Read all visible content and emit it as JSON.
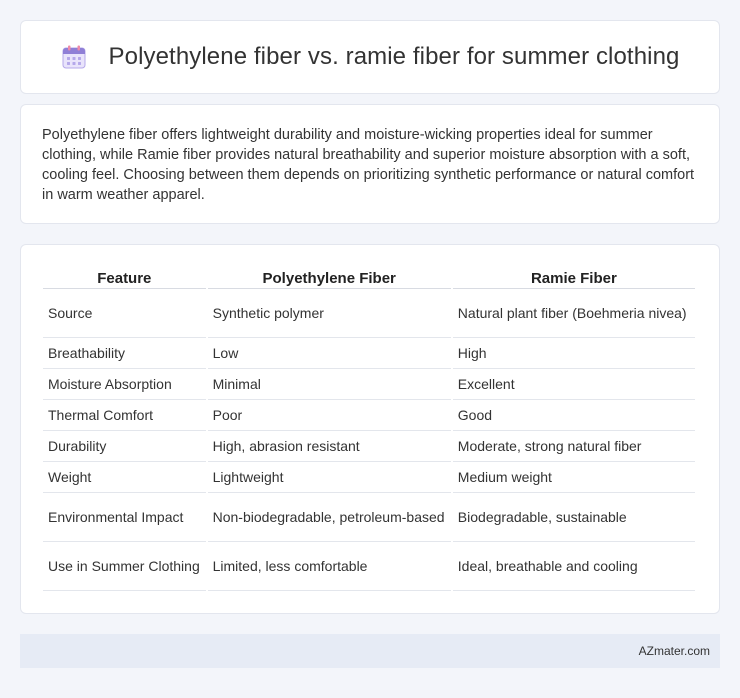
{
  "header": {
    "title": "Polyethylene fiber vs. ramie fiber for summer clothing",
    "icon": "calendar-icon"
  },
  "summary": {
    "text": "Polyethylene fiber offers lightweight durability and moisture-wicking properties ideal for summer clothing, while Ramie fiber provides natural breathability and superior moisture absorption with a soft, cooling feel. Choosing between them depends on prioritizing synthetic performance or natural comfort in warm weather apparel."
  },
  "table": {
    "headers": [
      "Feature",
      "Polyethylene Fiber",
      "Ramie Fiber"
    ],
    "rows": [
      [
        "Source",
        "Synthetic polymer",
        "Natural plant fiber (Boehmeria nivea)"
      ],
      [
        "Breathability",
        "Low",
        "High"
      ],
      [
        "Moisture Absorption",
        "Minimal",
        "Excellent"
      ],
      [
        "Thermal Comfort",
        "Poor",
        "Good"
      ],
      [
        "Durability",
        "High, abrasion resistant",
        "Moderate, strong natural fiber"
      ],
      [
        "Weight",
        "Lightweight",
        "Medium weight"
      ],
      [
        "Environmental Impact",
        "Non-biodegradable, petroleum-based",
        "Biodegradable, sustainable"
      ],
      [
        "Use in Summer Clothing",
        "Limited, less comfortable",
        "Ideal, breathable and cooling"
      ]
    ]
  },
  "footer": {
    "site": "AZmater.com"
  },
  "colors": {
    "page_bg": "#f3f5fa",
    "card_bg": "#ffffff",
    "footer_bg": "#e6ebf5",
    "icon_purple": "#8f7fd6",
    "icon_pink": "#f08aa8"
  }
}
